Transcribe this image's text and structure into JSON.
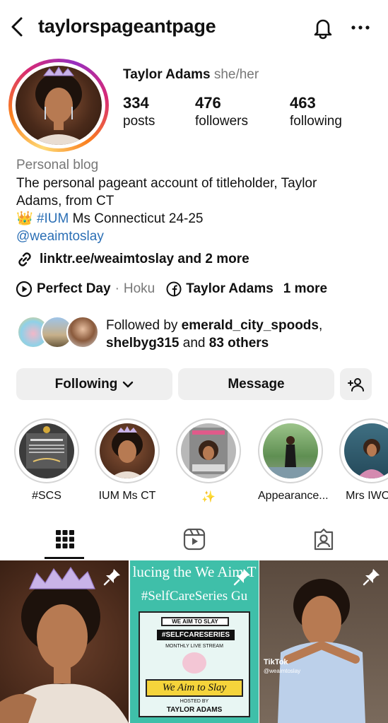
{
  "header": {
    "username": "taylorspageantpage",
    "back_icon": "chevron-left-icon",
    "bell_icon": "bell-icon",
    "more_icon": "more-horizontal-icon"
  },
  "profile": {
    "name": "Taylor Adams",
    "pronouns": "she/her",
    "stats": [
      {
        "value": "334",
        "label": "posts"
      },
      {
        "value": "476",
        "label": "followers"
      },
      {
        "value": "463",
        "label": "following"
      }
    ]
  },
  "bio": {
    "category": "Personal blog",
    "line1": "The personal pageant account of titleholder, Taylor",
    "line2": "Adams, from CT",
    "crown_emoji": "👑",
    "hashtag": "#IUM",
    "line3_rest": "Ms Connecticut 24-25",
    "mention": "@weaimtoslay",
    "links": "linktr.ee/weaimtoslay and 2 more",
    "song": "Perfect Day",
    "artist_sep": "·",
    "artist": "Hoku",
    "facebook_name": "Taylor Adams",
    "more_links": "1 more"
  },
  "followed_by": {
    "prefix": "Followed by",
    "user1": "emerald_city_spoods",
    "comma": ",",
    "user2": "shelbyg315",
    "and": "and",
    "others": "83 others"
  },
  "actions": {
    "following": "Following",
    "message": "Message",
    "add_icon": "person-add-icon"
  },
  "highlights": [
    {
      "label": "#SCS"
    },
    {
      "label": "IUM Ms CT"
    },
    {
      "label": "✨"
    },
    {
      "label": "Appearance..."
    },
    {
      "label": "Mrs IWOS"
    }
  ],
  "tabs": [
    "grid-icon",
    "reels-icon",
    "tagged-icon"
  ],
  "posts": [
    {
      "pinned": true
    },
    {
      "pinned": true,
      "overlay1": "lucing the We Aim T",
      "overlay2": "#SelfCareSeries Gu",
      "badge1": "WE AIM TO SLAY",
      "badge2": "#SELFCARESERIES",
      "badge3": "MONTHLY LIVE STREAM",
      "banner": "We Aim to Slay",
      "host1": "HOSTED BY",
      "host2": "TAYLOR ADAMS"
    },
    {
      "pinned": true,
      "tiktok": "TikTok",
      "tiktok_user": "@weaimtoslay"
    }
  ],
  "colors": {
    "accent_link": "#2b6fb5",
    "button_bg": "#efefef",
    "muted": "#777777"
  }
}
